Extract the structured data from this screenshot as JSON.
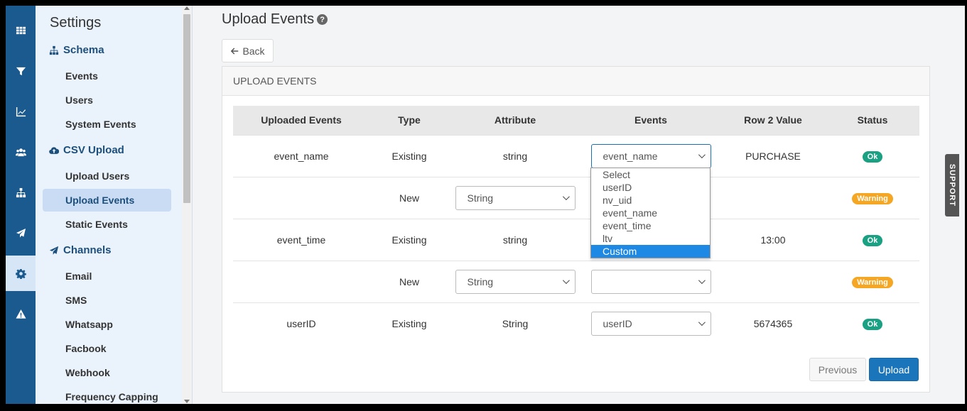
{
  "rail": {
    "items": [
      {
        "icon": "grid-icon"
      },
      {
        "icon": "funnel-icon"
      },
      {
        "icon": "line-chart-icon"
      },
      {
        "icon": "users-icon"
      },
      {
        "icon": "sitemap-icon"
      },
      {
        "icon": "paper-plane-icon"
      },
      {
        "icon": "gear-icon",
        "active": true
      },
      {
        "icon": "warning-icon"
      }
    ]
  },
  "sidebar": {
    "title": "Settings",
    "sections": [
      {
        "label": "Schema",
        "icon": "sitemap-icon",
        "items": [
          "Events",
          "Users",
          "System Events"
        ]
      },
      {
        "label": "CSV Upload",
        "icon": "cloud-upload-icon",
        "items": [
          "Upload Users",
          "Upload Events",
          "Static Events"
        ]
      },
      {
        "label": "Channels",
        "icon": "paper-plane-icon",
        "items": [
          "Email",
          "SMS",
          "Whatsapp",
          "Facbook",
          "Webhook",
          "Frequency Capping"
        ]
      }
    ],
    "active_item": "Upload Events"
  },
  "page": {
    "title": "Upload Events",
    "back_label": "Back",
    "panel_title": "UPLOAD EVENTS"
  },
  "table": {
    "headers": [
      "Uploaded Events",
      "Type",
      "Attribute",
      "Events",
      "Row 2 Value",
      "Status"
    ],
    "rows": [
      {
        "uploaded": "event_name",
        "type": "Existing",
        "attribute": "string",
        "event": "event_name",
        "row2": "PURCHASE",
        "status": "Ok"
      },
      {
        "uploaded": "",
        "type": "New",
        "attribute_select": "String",
        "event": "",
        "row2": "",
        "status": "Warning"
      },
      {
        "uploaded": "event_time",
        "type": "Existing",
        "attribute": "string",
        "event": "",
        "row2": "13:00",
        "status": "Ok"
      },
      {
        "uploaded": "",
        "type": "New",
        "attribute_select": "String",
        "event": "",
        "row2": "",
        "status": "Warning"
      },
      {
        "uploaded": "userID",
        "type": "Existing",
        "attribute": "String",
        "event": "userID",
        "row2": "5674365",
        "status": "Ok"
      }
    ]
  },
  "dropdown": {
    "options": [
      "Select",
      "userID",
      "nv_uid",
      "event_name",
      "event_time",
      "ltv",
      "Custom"
    ],
    "highlighted": "Custom"
  },
  "footer": {
    "previous_label": "Previous",
    "upload_label": "Upload"
  },
  "support_label": "SUPPORT",
  "colors": {
    "rail": "#1b5a8e",
    "ok": "#1aa083",
    "warning": "#f5a623",
    "primary": "#1b75bb"
  }
}
